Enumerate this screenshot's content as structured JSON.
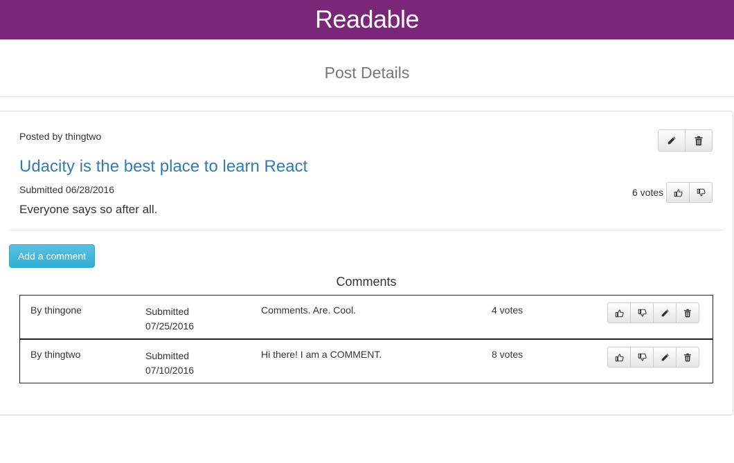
{
  "app": {
    "title": "Readable",
    "brand_color": "#7b2779"
  },
  "page": {
    "title": "Post Details"
  },
  "post": {
    "posted_by": "Posted by thingtwo",
    "title": "Udacity is the best place to learn React",
    "submitted": "Submitted 06/28/2016",
    "body": "Everyone says so after all.",
    "votes": "6 votes",
    "actions": [
      "pencil-icon",
      "trash-icon"
    ],
    "vote_icons": [
      "thumbs-up-icon",
      "thumbs-down-icon"
    ]
  },
  "add_comment_label": "Add a comment",
  "comments_heading": "Comments",
  "comments": [
    {
      "author": "By thingone",
      "submitted_label": "Submitted",
      "date": "07/25/2016",
      "body": "Comments. Are. Cool.",
      "votes": "4 votes"
    },
    {
      "author": "By thingtwo",
      "submitted_label": "Submitted",
      "date": "07/10/2016",
      "body": "Hi there! I am a COMMENT.",
      "votes": "8 votes"
    }
  ],
  "comment_action_icons": [
    "thumbs-up-icon",
    "thumbs-down-icon",
    "pencil-icon",
    "trash-icon"
  ]
}
